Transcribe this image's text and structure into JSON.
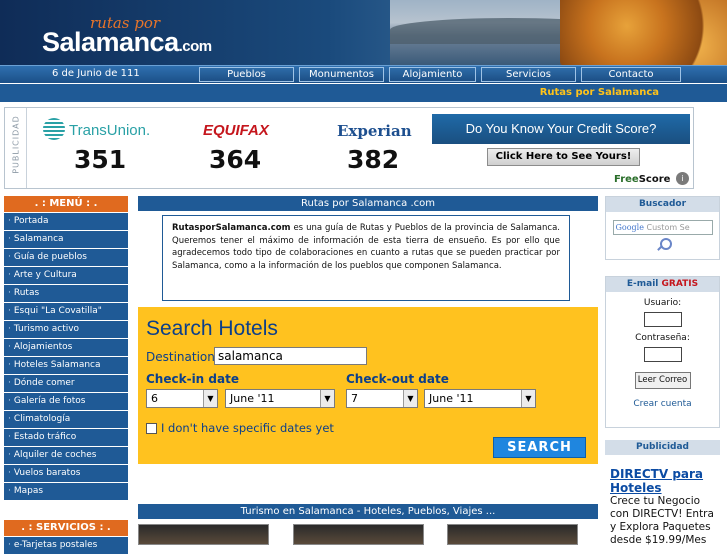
{
  "header": {
    "logo_small": "rutas por",
    "logo_big": "Salamanca",
    "logo_suffix": ".com"
  },
  "nav": {
    "date": "6 de Junio de 111",
    "items": [
      "Pueblos",
      "Monumentos",
      "Alojamiento",
      "Servicios",
      "Contacto"
    ]
  },
  "subbar": {
    "title": "Rutas por Salamanca"
  },
  "banner_ad": {
    "side_label": "PUBLICIDAD",
    "brands": [
      "TransUnion.",
      "EQUIFAX",
      "Experian"
    ],
    "scores": [
      "351",
      "364",
      "382"
    ],
    "headline": "Do You Know Your Credit Score?",
    "button": "Click Here to See Yours!",
    "sponsor_prefix": "Free",
    "sponsor_suffix": "Score",
    "colors": {
      "transunion": "#2aa1a6",
      "equifax": "#c5161d",
      "experian": "#1d4f8f"
    }
  },
  "menu": {
    "title": ". : MENÚ : .",
    "items": [
      "Portada",
      "Salamanca",
      "Guía de pueblos",
      "Arte y Cultura",
      "Rutas",
      "Esqui \"La Covatilla\"",
      "Turismo activo",
      "Alojamientos",
      "Hoteles Salamanca",
      "Dónde comer",
      "Galería de fotos",
      "Climatología",
      "Estado tráfico",
      "Alquiler de coches",
      "Vuelos baratos",
      "Mapas"
    ],
    "services_title": ". : SERVICIOS : .",
    "services_items": [
      "e-Tarjetas postales"
    ]
  },
  "center": {
    "section_title": "Rutas por Salamanca .com",
    "intro_brand": "RutasporSalamanca.com",
    "intro_text": " es una guía de Rutas y Pueblos de la provincia de Salamanca. Queremos tener el máximo de información de esta tierra de ensueño. Es por ello que agradecemos todo tipo de colaboraciones en cuanto a rutas que se pueden practicar por Salamanca, como a la información de los pueblos que componen Salamanca.",
    "tourism_title": "Turismo en Salamanca - Hoteles, Pueblos, Viajes ..."
  },
  "hotel_search": {
    "title": "Search Hotels",
    "destination_label": "Destination",
    "destination_value": "salamanca",
    "checkin_label": "Check-in date",
    "checkout_label": "Check-out date",
    "checkin_day": "6",
    "checkin_month": "June '11",
    "checkout_day": "7",
    "checkout_month": "June '11",
    "no_dates_label": "I don't have specific dates yet",
    "search_button": "SEARCH"
  },
  "sidebar_right": {
    "search_title": "Buscador",
    "search_logo": "Google",
    "search_placeholder": "Custom Se",
    "email_title_prefix": "E-mail ",
    "email_title_highlight": "GRATIS",
    "user_label": "Usuario:",
    "password_label": "Contraseña:",
    "read_button": "Leer Correo",
    "create_link": "Crear cuenta",
    "ads_title": "Publicidad",
    "ad_headline": "DIRECTV para Hoteles",
    "ad_body": "Crece tu Negocio con DIRECTV! Entra y Explora Paquetes desde $19.99/Mes"
  }
}
